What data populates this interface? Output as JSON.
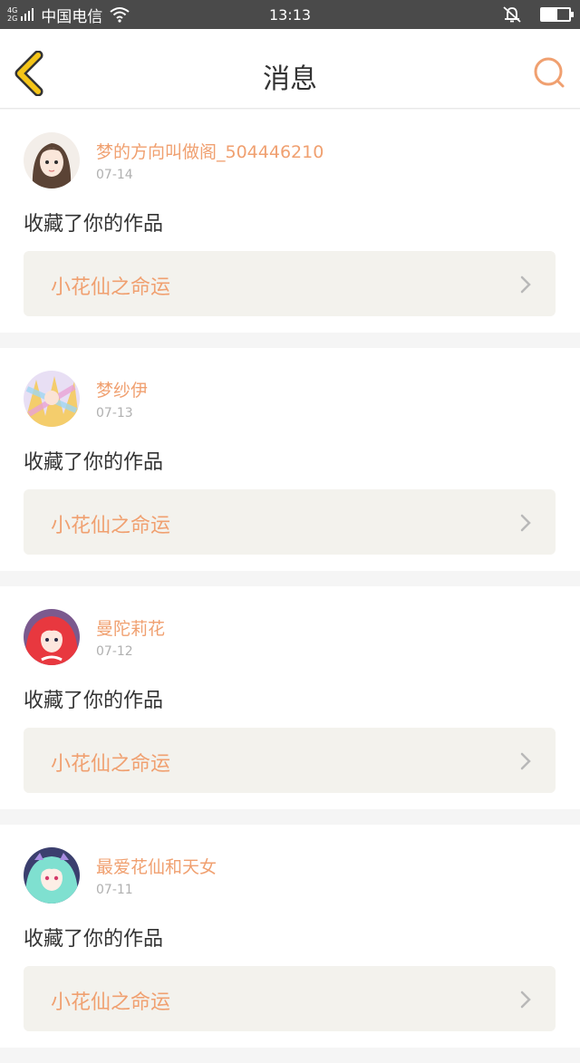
{
  "status_bar": {
    "network_top": "4G",
    "network_bottom": "2G",
    "carrier": "中国电信",
    "time": "13:13",
    "battery_level": 0.55
  },
  "navbar": {
    "title": "消息"
  },
  "messages": [
    {
      "username": "梦的方向叫做阁_504446210",
      "date": "07-14",
      "action": "收藏了你的作品",
      "work_title": "小花仙之命运"
    },
    {
      "username": "梦纱伊",
      "date": "07-13",
      "action": "收藏了你的作品",
      "work_title": "小花仙之命运"
    },
    {
      "username": "曼陀莉花",
      "date": "07-12",
      "action": "收藏了你的作品",
      "work_title": "小花仙之命运"
    },
    {
      "username": "最爱花仙和天女",
      "date": "07-11",
      "action": "收藏了你的作品",
      "work_title": "小花仙之命运"
    }
  ],
  "colors": {
    "accent": "#f0a070",
    "back_arrow": "#f5c518",
    "back_arrow_outline": "#333333",
    "statusbar_bg": "#4a4a4a"
  }
}
